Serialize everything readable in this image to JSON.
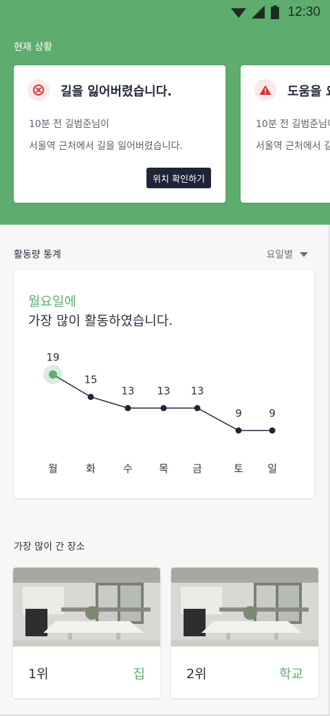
{
  "status_bar": {
    "time": "12:30"
  },
  "current_status": {
    "title": "현재 상황",
    "cards": [
      {
        "icon": "lost-icon",
        "title": "길을 잃어버렸습니다.",
        "line1": "10분 전 길범준님이",
        "line2": "서울역 근처에서 길을 잃어버렸습니다.",
        "button": "위치 확인하기"
      },
      {
        "icon": "warning-icon",
        "title": "도움을 요",
        "line1": "10분 전 길범준님이",
        "line2": "서울역 근처에서 길"
      }
    ]
  },
  "activity": {
    "title": "활동량 통계",
    "filter": "요일별",
    "highlight_day": "월요일에",
    "highlight_text": "가장 많이 활동하였습니다."
  },
  "chart_data": {
    "type": "line",
    "categories": [
      "월",
      "화",
      "수",
      "목",
      "금",
      "토",
      "일"
    ],
    "values": [
      19,
      15,
      13,
      13,
      13,
      9,
      9
    ],
    "highlight_index": 0,
    "colors": {
      "line": "#1f2437",
      "highlight": "#5ead6e"
    }
  },
  "places": {
    "title": "가장 많이 간 장소",
    "items": [
      {
        "rank": "1위",
        "name": "집"
      },
      {
        "rank": "2위",
        "name": "학교"
      }
    ]
  },
  "colors": {
    "accent": "#5ead6e",
    "dark": "#1f2437",
    "alert": "#d0343a"
  }
}
